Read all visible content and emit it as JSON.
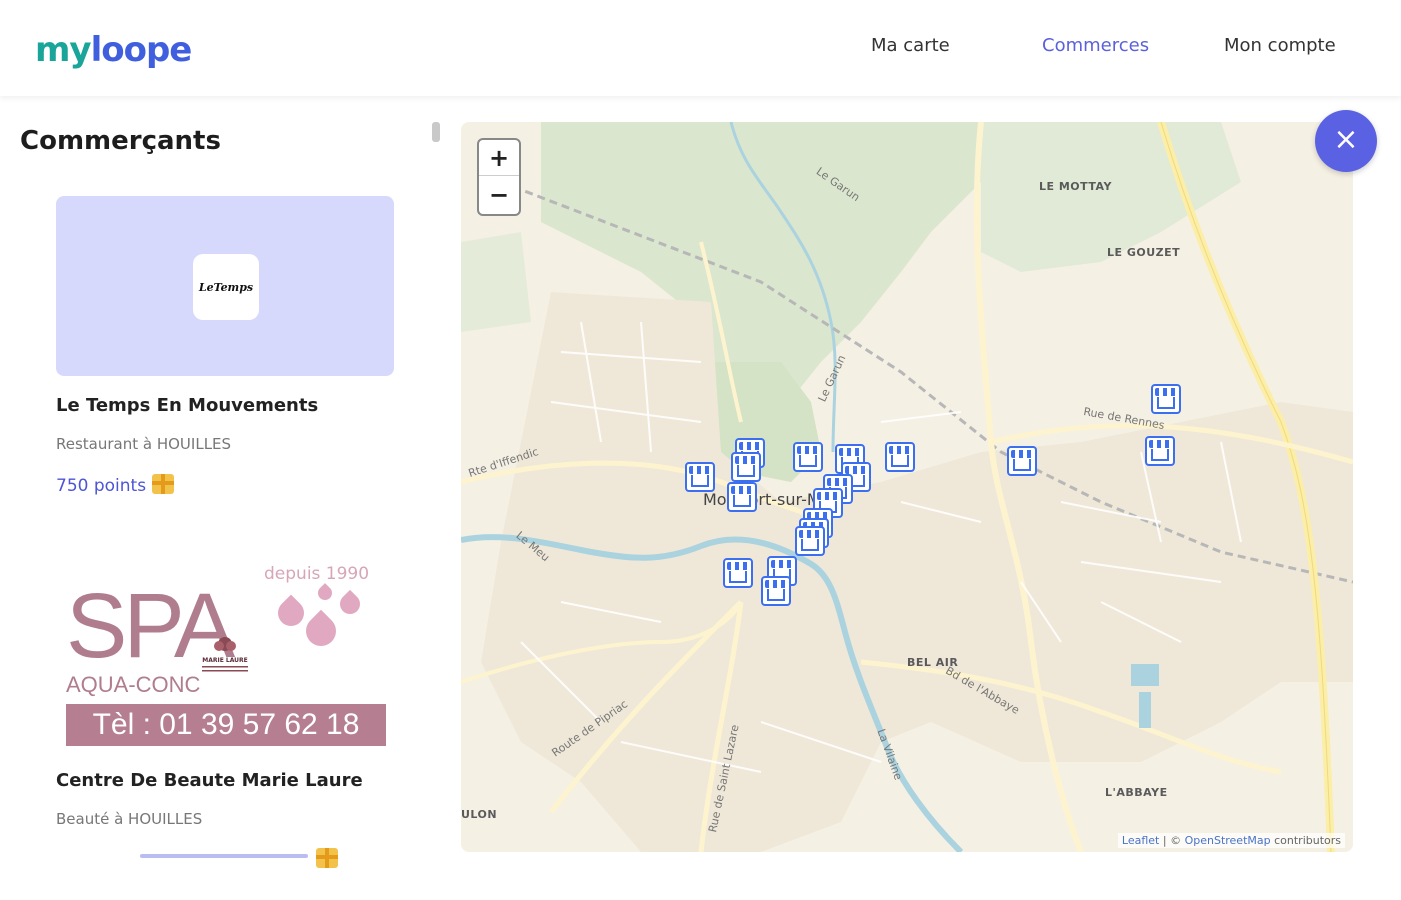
{
  "header": {
    "logo_part1": "my",
    "logo_part2": "loope",
    "nav": [
      {
        "label": "Ma carte",
        "active": false
      },
      {
        "label": "Commerces",
        "active": true
      },
      {
        "label": "Mon compte",
        "active": false
      }
    ]
  },
  "sidebar": {
    "title": "Commerçants",
    "cards": [
      {
        "name": "Le Temps En Mouvements",
        "subtitle": "Restaurant à HOUILLES",
        "points": "750 points",
        "logo_text": "LeTemps"
      },
      {
        "name": "Centre De Beaute Marie Laure",
        "subtitle": "Beauté à HOUILLES",
        "image": {
          "headline": "SPA",
          "since": "depuis 1990",
          "tagline": "AQUA-CONC",
          "phone": "Tèl : 01 39 57 62 18",
          "emblem": "MARIE LAURE"
        }
      }
    ]
  },
  "map": {
    "zoom_in": "+",
    "zoom_out": "−",
    "places": [
      {
        "name": "LE MOTTAY"
      },
      {
        "name": "LE GOUZET"
      },
      {
        "name": "BEL AIR"
      },
      {
        "name": "L'ABBAYE"
      },
      {
        "name": "ULON"
      }
    ],
    "roads": [
      "Le Garun",
      "Le Garun",
      "Rte d'Iffendic",
      "Rue de Rennes",
      "Route de Pipriac",
      "Rue de Saint Lazare",
      "Bd de l'Abbaye",
      "Le Meu",
      "La Vilaine"
    ],
    "town": "Montfort-sur-Meu",
    "attribution_link1": "Leaflet",
    "attribution_sep": " | © ",
    "attribution_link2": "OpenStreetMap",
    "attribution_tail": " contributors",
    "markers_count": 22
  },
  "close_icon": "×",
  "colors": {
    "accent": "#5b61e3",
    "logo_teal": "#1aa59a",
    "logo_blue": "#3f5fdf",
    "marker": "#3c6ff0"
  }
}
